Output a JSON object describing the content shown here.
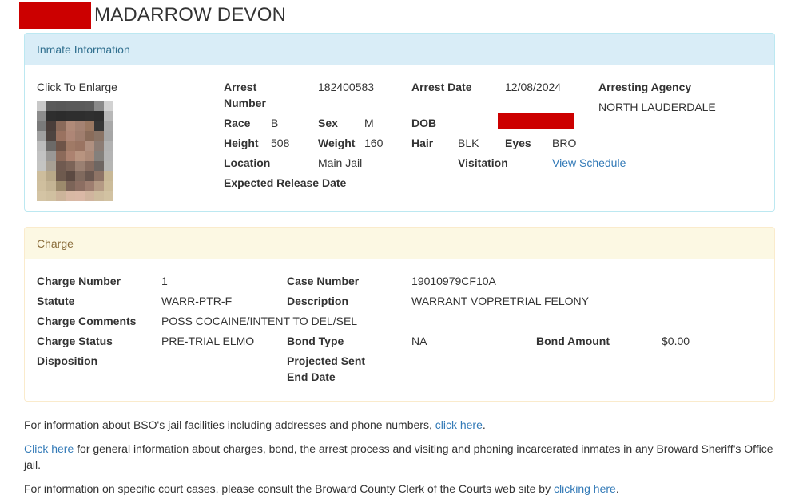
{
  "page": {
    "title": "MADARROW DEVON"
  },
  "inmate_panel": {
    "heading": "Inmate Information",
    "photo_caption": "Click To Enlarge",
    "fields": {
      "arrest_number": {
        "label_line1": "Arrest",
        "label_line2": "Number",
        "value": "182400583"
      },
      "arrest_date": {
        "label": "Arrest Date",
        "value": "12/08/2024"
      },
      "arresting_agency": {
        "label": "Arresting Agency",
        "value": "NORTH LAUDERDALE"
      },
      "race": {
        "label": "Race",
        "value": "B"
      },
      "sex": {
        "label": "Sex",
        "value": "M"
      },
      "dob": {
        "label": "DOB",
        "value": "[REDACTED]"
      },
      "height": {
        "label": "Height",
        "value": "508"
      },
      "weight": {
        "label": "Weight",
        "value": "160"
      },
      "hair": {
        "label": "Hair",
        "value": "BLK"
      },
      "eyes": {
        "label": "Eyes",
        "value": "BRO"
      },
      "location": {
        "label": "Location",
        "value": "Main Jail"
      },
      "visitation": {
        "label": "Visitation",
        "link_text": "View Schedule"
      },
      "expected_release_date": {
        "label": "Expected Release Date",
        "value": ""
      }
    }
  },
  "charge_panel": {
    "heading": "Charge",
    "fields": {
      "charge_number": {
        "label": "Charge Number",
        "value": "1"
      },
      "case_number": {
        "label": "Case Number",
        "value": "19010979CF10A"
      },
      "statute": {
        "label": "Statute",
        "value": "WARR-PTR-F"
      },
      "description": {
        "label": "Description",
        "value": "WARRANT VOPRETRIAL FELONY"
      },
      "charge_comments": {
        "label": "Charge Comments",
        "value": "POSS COCAINE/INTENT TO DEL/SEL"
      },
      "charge_status": {
        "label": "Charge Status",
        "value": "PRE-TRIAL ELMO"
      },
      "bond_type": {
        "label": "Bond Type",
        "value": "NA"
      },
      "bond_amount": {
        "label": "Bond Amount",
        "value": "$0.00"
      },
      "disposition": {
        "label": "Disposition",
        "value": ""
      },
      "projected_sent_end_date": {
        "label_line1": "Projected Sent",
        "label_line2": "End Date",
        "value": ""
      }
    }
  },
  "footer": {
    "p1_text": "For information about BSO's jail facilities including addresses and phone numbers, ",
    "p1_link": "click here",
    "p1_end": ".",
    "p2_link": "Click here",
    "p2_text": " for general information about charges, bond, the arrest process and visiting and phoning incarcerated inmates in any Broward Sheriff's Office jail.",
    "p3_text": "For information on specific court cases, please consult the Broward County Clerk of the Courts web site by ",
    "p3_link": "clicking here",
    "p3_end": "."
  },
  "colors": {
    "redaction": "#cc0000",
    "link": "#337ab7",
    "info_heading_bg": "#d9edf7",
    "warning_heading_bg": "#fcf8e3"
  }
}
